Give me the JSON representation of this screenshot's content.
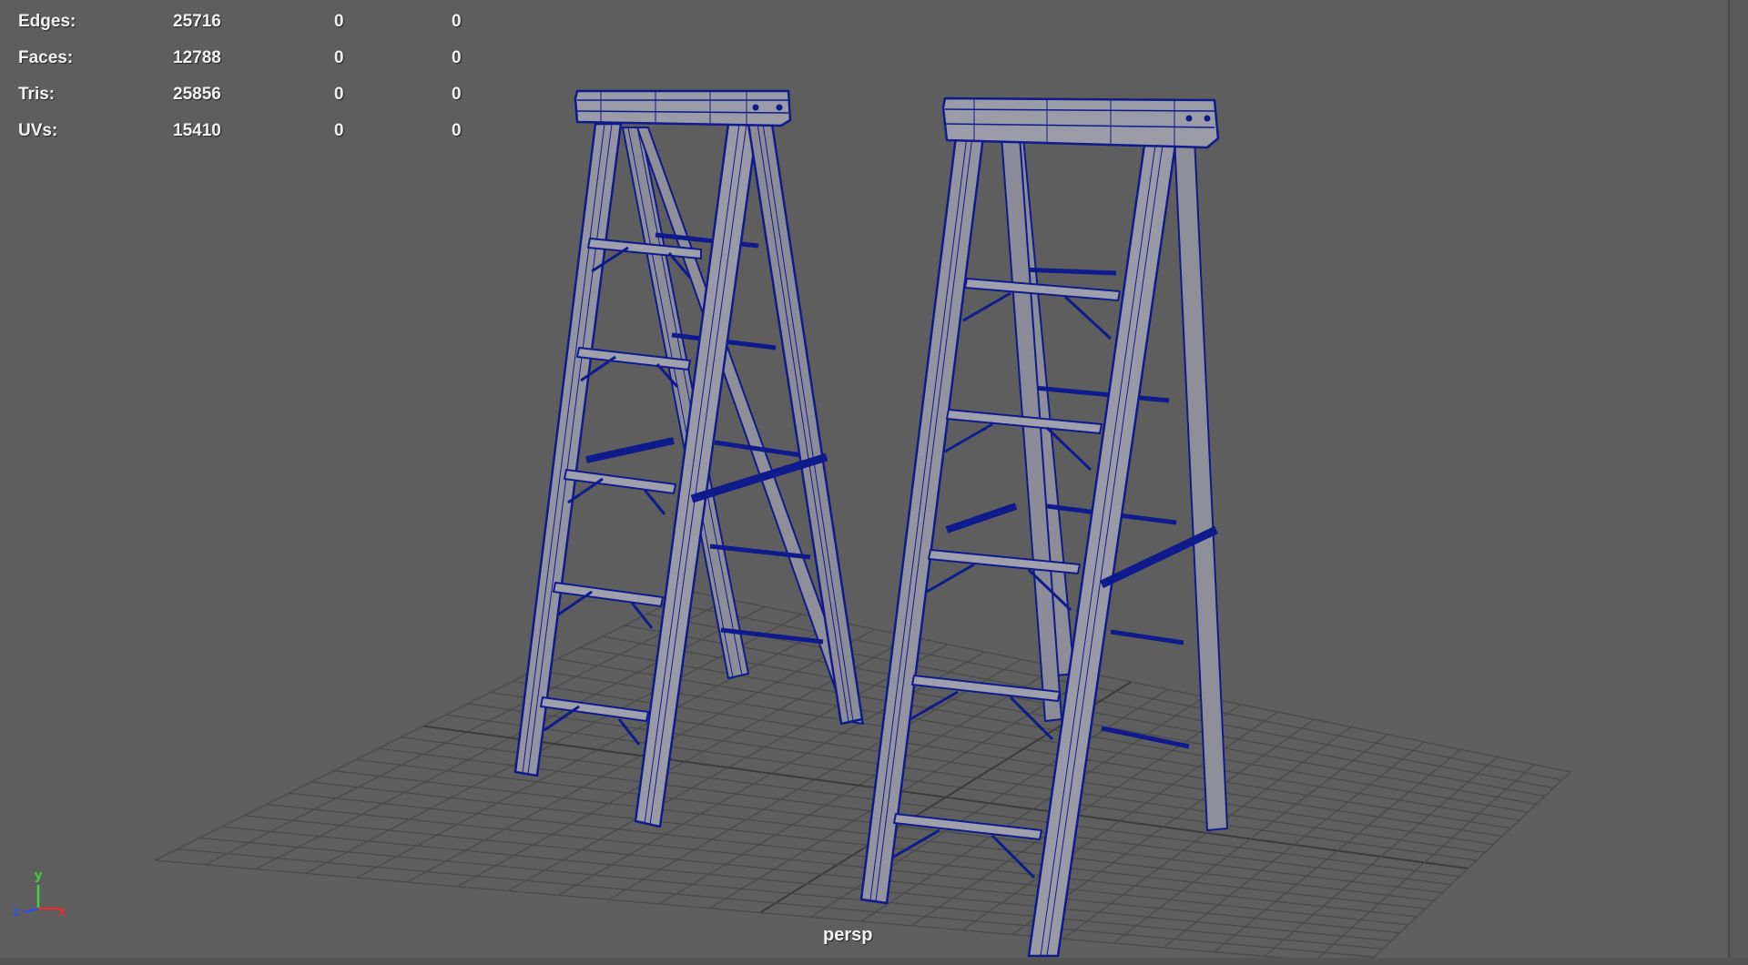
{
  "hud": {
    "rows": [
      {
        "label": "Edges:",
        "v1": "25716",
        "v2": "0",
        "v3": "0"
      },
      {
        "label": "Faces:",
        "v1": "12788",
        "v2": "0",
        "v3": "0"
      },
      {
        "label": "Tris:",
        "v1": "25856",
        "v2": "0",
        "v3": "0"
      },
      {
        "label": "UVs:",
        "v1": "15410",
        "v2": "0",
        "v3": "0"
      }
    ]
  },
  "viewport": {
    "camera_label": "persp",
    "background_color": "#5e5e5e",
    "wireframe_color": "#0f1a8c",
    "mesh_color": "#8f8f9a",
    "grid_color": "#4a4a4a"
  },
  "axis_gizmo": {
    "y_label": "y",
    "z_label": "z",
    "x_label": "x",
    "y_color": "#3cd93c",
    "x_color": "#e03030",
    "z_color": "#3050e0"
  },
  "scene_objects": [
    "ladder-left-icon",
    "ladder-right-icon"
  ]
}
